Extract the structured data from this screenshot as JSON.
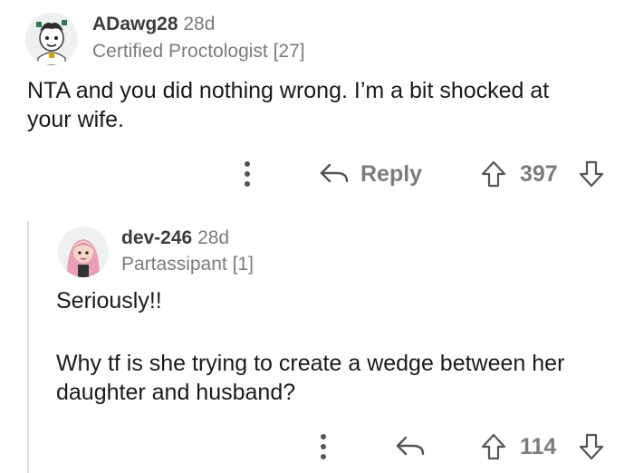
{
  "comments": [
    {
      "username": "ADawg28",
      "age": "28d",
      "flair": "Certified Proctologist [27]",
      "body": [
        "NTA and you did nothing wrong. I’m a bit shocked at",
        "your wife."
      ],
      "actions": {
        "reply_label": "Reply",
        "score": "397"
      },
      "icons": {
        "avatar": "avatar-icon",
        "more": "more-options-icon",
        "reply": "reply-arrow-icon",
        "upvote": "upvote-icon",
        "downvote": "downvote-icon"
      }
    },
    {
      "username": "dev-246",
      "age": "28d",
      "flair": "Partassipant [1]",
      "body_paragraph_1": "Seriously!!",
      "body_paragraph_2": [
        "Why tf is she trying to create a wedge between her",
        "daughter and husband?"
      ],
      "actions": {
        "score": "114"
      },
      "icons": {
        "avatar": "avatar-icon",
        "more": "more-options-icon",
        "reply": "reply-arrow-icon",
        "upvote": "upvote-icon",
        "downvote": "downvote-icon"
      }
    }
  ],
  "colors": {
    "text": "#1a1a1b",
    "muted": "#7c7c7c",
    "thread_line": "#e0e0e0",
    "background": "#ffffff"
  }
}
